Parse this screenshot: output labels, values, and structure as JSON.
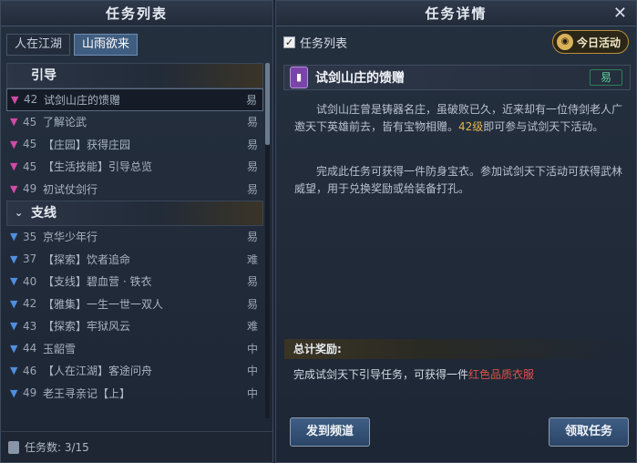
{
  "left": {
    "title": "任务列表",
    "tabs": [
      {
        "label": "人在江湖",
        "active": false
      },
      {
        "label": "山雨欲来",
        "active": true
      }
    ],
    "sections": [
      {
        "header": "引导",
        "items": [
          {
            "level": "42",
            "name": "试剑山庄的馈赠",
            "difficulty": "易",
            "selected": true
          },
          {
            "level": "45",
            "name": "了解论武",
            "difficulty": "易"
          },
          {
            "level": "45",
            "name": "【庄园】获得庄园",
            "difficulty": "易"
          },
          {
            "level": "45",
            "name": "【生活技能】引导总览",
            "difficulty": "易"
          },
          {
            "level": "49",
            "name": "初试仗剑行",
            "difficulty": "易"
          }
        ]
      },
      {
        "header": "支线",
        "items": [
          {
            "level": "35",
            "name": "京华少年行",
            "difficulty": "易"
          },
          {
            "level": "37",
            "name": "【探索】饮者追命",
            "difficulty": "难"
          },
          {
            "level": "40",
            "name": "【支线】碧血营 · 铁衣",
            "difficulty": "易"
          },
          {
            "level": "42",
            "name": "【雅集】一生一世一双人",
            "difficulty": "易"
          },
          {
            "level": "43",
            "name": "【探索】牢狱风云",
            "difficulty": "难"
          },
          {
            "level": "44",
            "name": "玉龆雪",
            "difficulty": "中"
          },
          {
            "level": "46",
            "name": "【人在江湖】客途问舟",
            "difficulty": "中"
          },
          {
            "level": "49",
            "name": "老王寻亲记【上】",
            "difficulty": "中"
          }
        ]
      }
    ],
    "footer": "任务数: 3/15"
  },
  "right": {
    "title": "任务详情",
    "close": "✕",
    "checkbox_label": "任务列表",
    "today_label": "今日活动",
    "quest_title": "试剑山庄的馈赠",
    "quest_difficulty": "易",
    "desc1_a": "试剑山庄曾是铸器名庄，虽破败已久，近来却有一位侍剑老人广邀天下英雄前去，皆有宝物相赠。",
    "desc1_b": "42级",
    "desc1_c": "即可参与试剑天下活动。",
    "desc2": "完成此任务可获得一件防身宝衣。参加试剑天下活动可获得武林威望，用于兑换奖励或给装备打孔。",
    "reward_header": "总计奖励:",
    "reward_a": "完成试剑天下引导任务，可获得一件",
    "reward_b": "红色品质衣服",
    "btn_channel": "发到频道",
    "btn_accept": "领取任务"
  },
  "colors": {
    "main_quest_mark": "#d04aa6",
    "side_quest_mark": "#4e8fe0",
    "gold": "#e2b44f",
    "red": "#e0504a",
    "easy_green": "#59d39a"
  }
}
